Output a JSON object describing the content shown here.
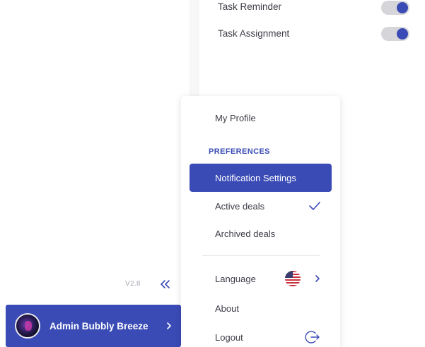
{
  "settings": {
    "task_reminder_label": "Task Reminder",
    "task_assignment_label": "Task Assignment"
  },
  "sidebar": {
    "version": "V2.8",
    "user_name": "Admin Bubbly Breeze"
  },
  "menu": {
    "my_profile": "My Profile",
    "preferences_heading": "PREFERENCES",
    "notification_settings": "Notification Settings",
    "active_deals": "Active deals",
    "archived_deals": "Archived deals",
    "language": "Language",
    "about": "About",
    "logout": "Logout"
  },
  "colors": {
    "accent": "#3a4bb5",
    "toggle_track": "#d6d6da"
  },
  "icons": [
    "double-chevron-left-icon",
    "chevron-right-icon",
    "check-icon",
    "us-flag-icon",
    "logout-icon"
  ]
}
